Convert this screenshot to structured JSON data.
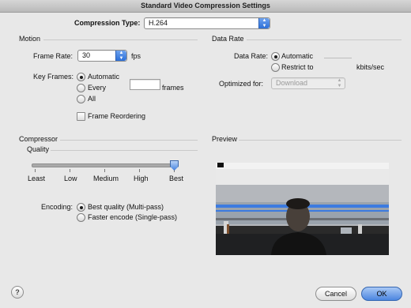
{
  "window": {
    "title": "Standard Video Compression Settings"
  },
  "compression_type": {
    "label": "Compression Type:",
    "value": "H.264"
  },
  "motion": {
    "section_title": "Motion",
    "frame_rate_label": "Frame Rate:",
    "frame_rate_value": "30",
    "frame_rate_unit": "fps",
    "key_frames_label": "Key Frames:",
    "key_frames_options": [
      "Automatic",
      "Every",
      "All"
    ],
    "key_frames_selected": "Automatic",
    "frames_unit": "frames",
    "frame_reordering_label": "Frame Reordering",
    "frame_reordering_checked": false
  },
  "data_rate": {
    "section_title": "Data Rate",
    "label": "Data Rate:",
    "options": [
      "Automatic",
      "Restrict to"
    ],
    "selected": "Automatic",
    "unit": "kbits/sec",
    "optimized_label": "Optimized for:",
    "optimized_value": "Download"
  },
  "compressor": {
    "section_title": "Compressor",
    "quality_label": "Quality",
    "quality_ticks": [
      "Least",
      "Low",
      "Medium",
      "High",
      "Best"
    ],
    "quality_level": "Best",
    "encoding_label": "Encoding:",
    "encoding_options": [
      "Best quality (Multi-pass)",
      "Faster encode (Single-pass)"
    ],
    "encoding_selected": "Best quality (Multi-pass)"
  },
  "preview": {
    "section_title": "Preview"
  },
  "buttons": {
    "help": "?",
    "cancel": "Cancel",
    "ok": "OK"
  },
  "icons": {
    "help": "help-icon",
    "popup_arrows": "up-down-arrows-icon"
  },
  "colors": {
    "accent": "#4b86e0",
    "window_bg": "#e8e8e8"
  }
}
